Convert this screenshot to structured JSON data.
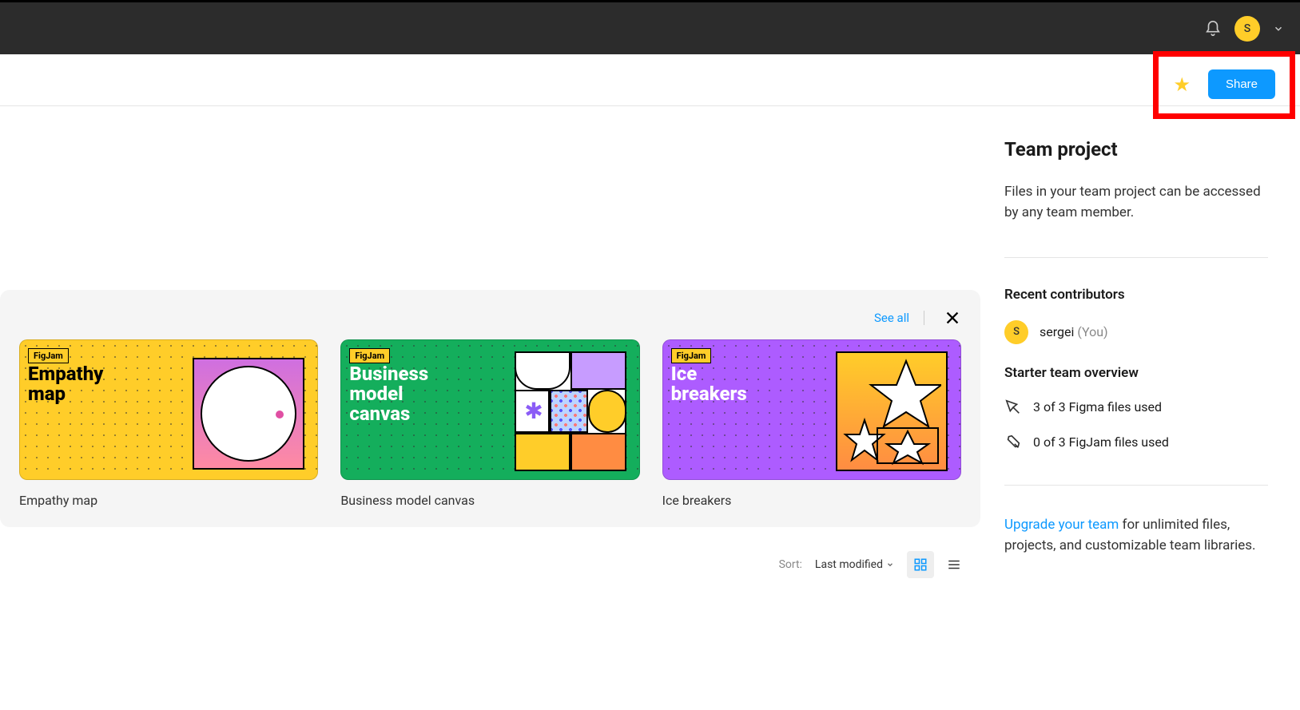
{
  "topbar": {
    "avatar_initial": "S"
  },
  "share": {
    "label": "Share"
  },
  "templates": {
    "see_all": "See all",
    "cards": [
      {
        "title": "Empathy map",
        "badge": "FigJam",
        "label": "Empathy\nmap"
      },
      {
        "title": "Business model canvas",
        "badge": "FigJam",
        "label": "Business\nmodel\ncanvas"
      },
      {
        "title": "Ice breakers",
        "badge": "FigJam",
        "label": "Ice\nbreakers"
      }
    ]
  },
  "sort": {
    "label": "Sort:",
    "value": "Last modified"
  },
  "sidebar": {
    "title": "Team project",
    "description": "Files in your team project can be accessed by any team member.",
    "recent_heading": "Recent contributors",
    "contributor": {
      "initial": "S",
      "name": "sergei",
      "you": "(You)"
    },
    "overview_heading": "Starter team overview",
    "figma_usage": "3 of 3 Figma files used",
    "figjam_usage": "0 of 3 FigJam files used",
    "upgrade_link": "Upgrade your team",
    "upgrade_rest": " for unlimited files, projects, and customizable team libraries."
  }
}
